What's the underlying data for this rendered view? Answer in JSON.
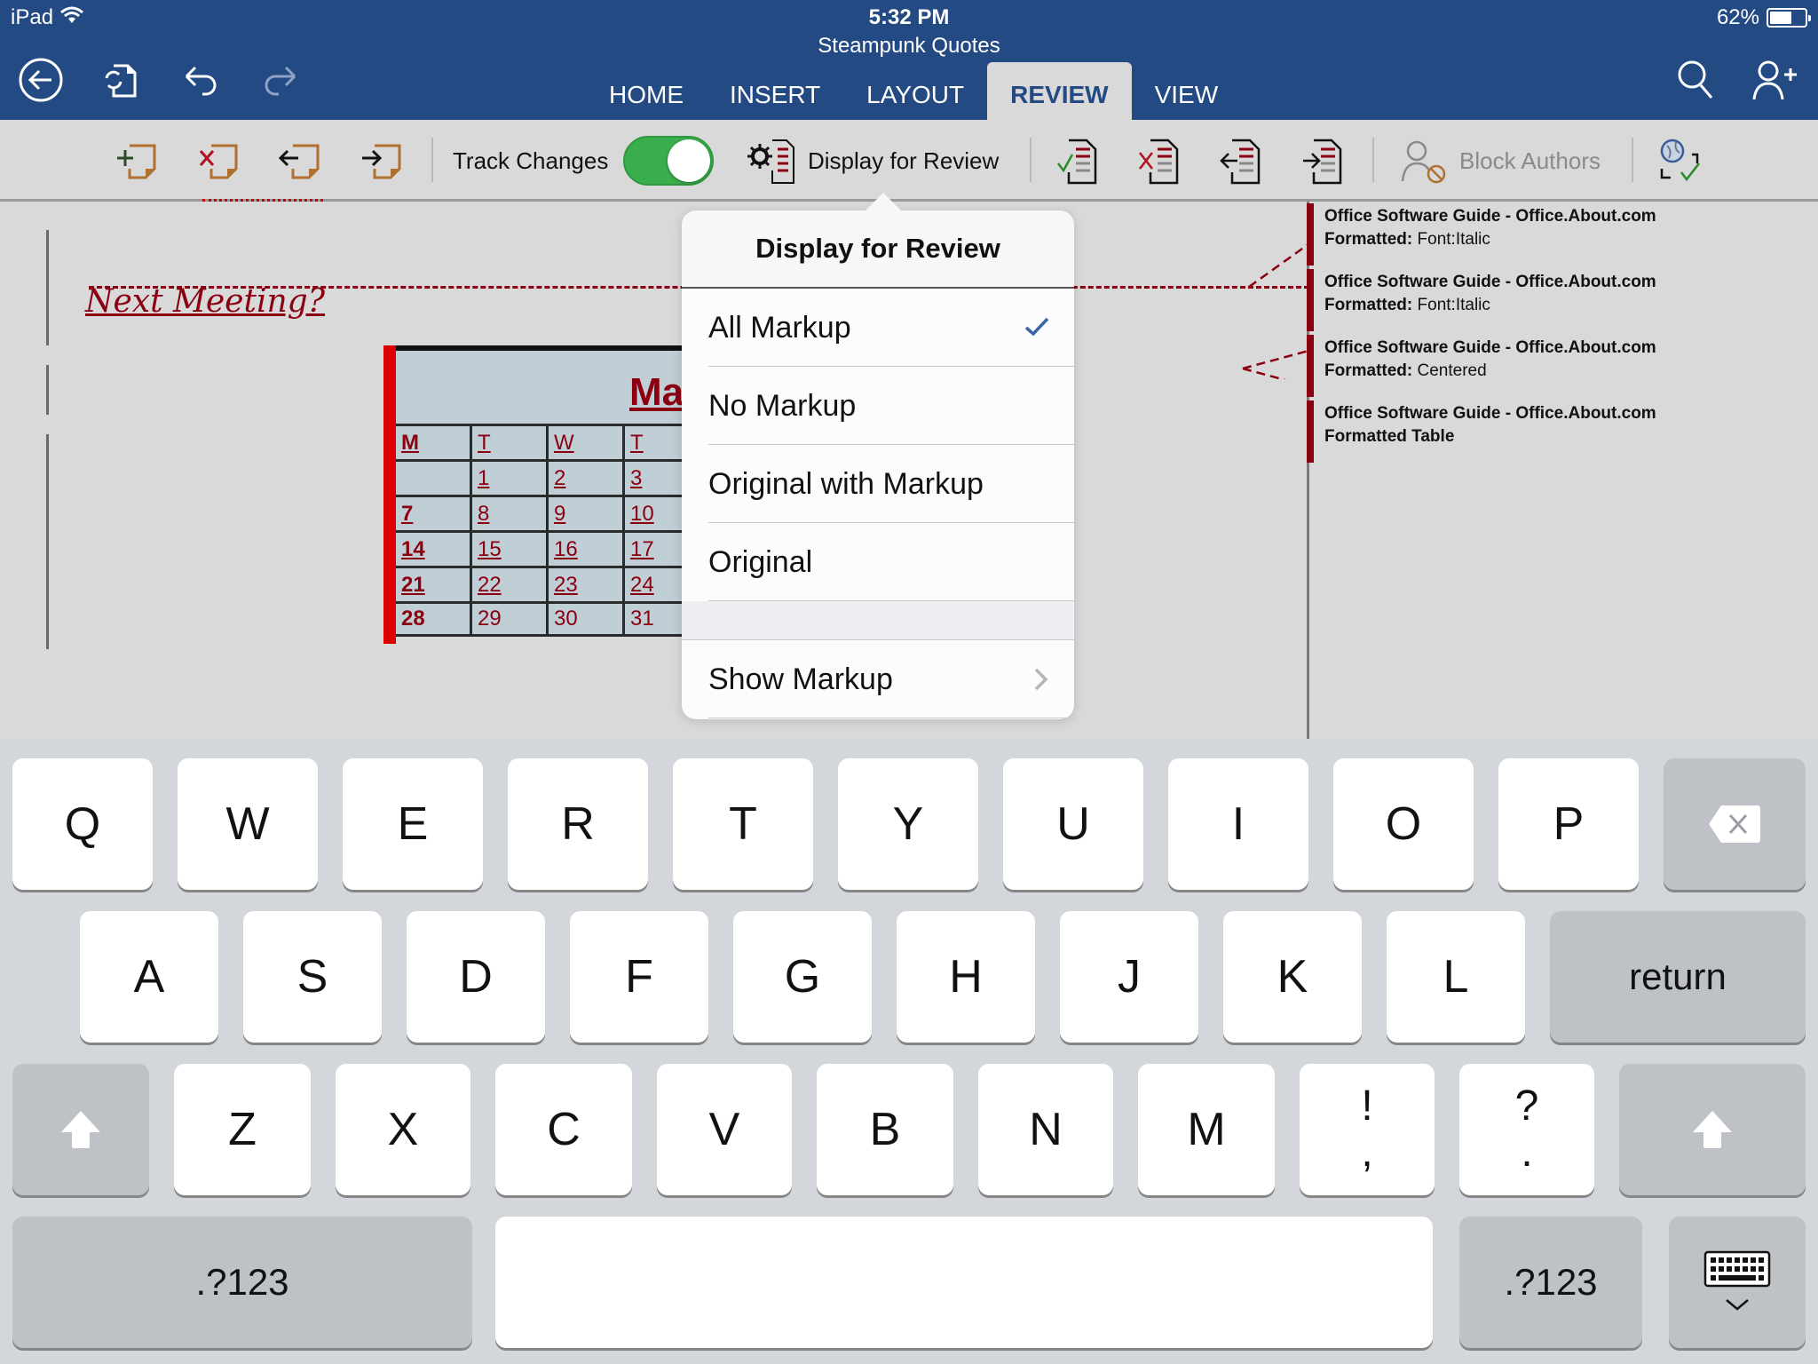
{
  "status_bar": {
    "device": "iPad",
    "time": "5:32 PM",
    "battery_percent_label": "62%",
    "battery_level": 0.62
  },
  "header": {
    "document_title": "Steampunk Quotes",
    "left_icons": [
      "back-icon",
      "sync-document-icon",
      "undo-icon",
      "redo-icon"
    ],
    "right_icons": [
      "search-icon",
      "share-add-person-icon"
    ],
    "tabs": [
      {
        "label": "HOME",
        "active": false
      },
      {
        "label": "INSERT",
        "active": false
      },
      {
        "label": "LAYOUT",
        "active": false
      },
      {
        "label": "REVIEW",
        "active": true
      },
      {
        "label": "VIEW",
        "active": false
      }
    ]
  },
  "toolbar": {
    "comment_icons": [
      "new-comment-icon",
      "delete-comment-icon",
      "previous-comment-icon",
      "next-comment-icon"
    ],
    "track_changes_label": "Track Changes",
    "track_changes_on": true,
    "display_for_review_label": "Display for Review",
    "change_icons": [
      "accept-change-icon",
      "reject-change-icon",
      "previous-change-icon",
      "next-change-icon"
    ],
    "block_authors_label": "Block Authors",
    "last_icon": "sync-check-icon"
  },
  "document": {
    "heading": "Next Meeting?",
    "calendar": {
      "month": "Ma",
      "headers": [
        "M",
        "T",
        "W",
        "T"
      ],
      "rows": [
        [
          "",
          "1",
          "2",
          "3"
        ],
        [
          "7",
          "8",
          "9",
          "10"
        ],
        [
          "14",
          "15",
          "16",
          "17"
        ],
        [
          "21",
          "22",
          "23",
          "24"
        ],
        [
          "28",
          "29",
          "30",
          "31"
        ]
      ]
    },
    "comments": [
      {
        "author": "Office Software Guide - Office.About.com",
        "kind": "Formatted:",
        "detail": "Font:Italic"
      },
      {
        "author": "Office Software Guide - Office.About.com",
        "kind": "Formatted:",
        "detail": "Font:Italic"
      },
      {
        "author": "Office Software Guide - Office.About.com",
        "kind": "Formatted:",
        "detail": "Centered"
      },
      {
        "author": "Office Software Guide - Office.About.com",
        "kind": "Formatted Table",
        "detail": ""
      }
    ]
  },
  "popover": {
    "title": "Display for Review",
    "options": [
      {
        "label": "All Markup",
        "selected": true
      },
      {
        "label": "No Markup",
        "selected": false
      },
      {
        "label": "Original with Markup",
        "selected": false
      },
      {
        "label": "Original",
        "selected": false
      }
    ],
    "show_markup_label": "Show Markup"
  },
  "keyboard": {
    "row1": [
      "Q",
      "W",
      "E",
      "R",
      "T",
      "Y",
      "U",
      "I",
      "O",
      "P"
    ],
    "row2": [
      "A",
      "S",
      "D",
      "F",
      "G",
      "H",
      "J",
      "K",
      "L"
    ],
    "row3": [
      "Z",
      "X",
      "C",
      "V",
      "B",
      "N",
      "M"
    ],
    "punct1": {
      "top": "!",
      "bottom": ","
    },
    "punct2": {
      "top": "?",
      "bottom": "."
    },
    "return_label": "return",
    "numbers_label": ".?123"
  }
}
